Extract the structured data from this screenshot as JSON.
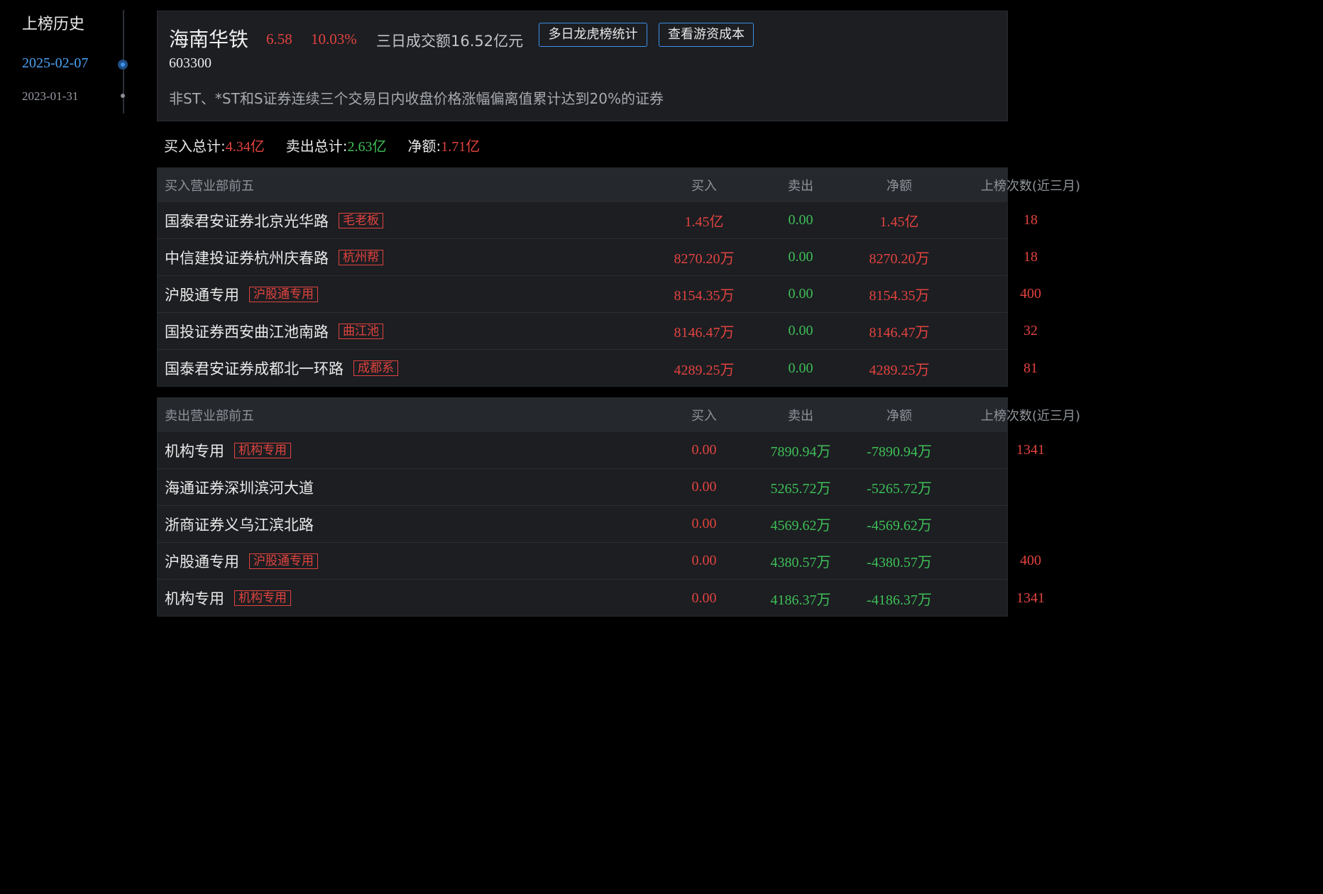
{
  "history": {
    "title": "上榜历史",
    "dates": [
      {
        "label": "2025-02-07",
        "active": true
      },
      {
        "label": "2023-01-31",
        "active": false
      }
    ]
  },
  "stock": {
    "name": "海南华铁",
    "price": "6.58",
    "change_pct": "10.03%",
    "turnover": "三日成交额16.52亿元",
    "code": "603300",
    "reason": "非ST、*ST和S证券连续三个交易日内收盘价格涨幅偏离值累计达到20%的证券",
    "buttons": {
      "multi_day": "多日龙虎榜统计",
      "cost": "查看游资成本"
    }
  },
  "totals": {
    "buy_label": "买入总计:",
    "buy_value": "4.34亿",
    "sell_label": "卖出总计:",
    "sell_value": "2.63亿",
    "net_label": "净额:",
    "net_value": "1.71亿"
  },
  "buy_table": {
    "headers": {
      "name": "买入营业部前五",
      "buy": "买入",
      "sell": "卖出",
      "net": "净额",
      "count": "上榜次数(近三月)"
    },
    "rows": [
      {
        "name": "国泰君安证券北京光华路",
        "tag": "毛老板",
        "buy": "1.45亿",
        "sell": "0.00",
        "net": "1.45亿",
        "count": "18"
      },
      {
        "name": "中信建投证券杭州庆春路",
        "tag": "杭州帮",
        "buy": "8270.20万",
        "sell": "0.00",
        "net": "8270.20万",
        "count": "18"
      },
      {
        "name": "沪股通专用",
        "tag": "沪股通专用",
        "buy": "8154.35万",
        "sell": "0.00",
        "net": "8154.35万",
        "count": "400"
      },
      {
        "name": "国投证券西安曲江池南路",
        "tag": "曲江池",
        "buy": "8146.47万",
        "sell": "0.00",
        "net": "8146.47万",
        "count": "32"
      },
      {
        "name": "国泰君安证券成都北一环路",
        "tag": "成都系",
        "buy": "4289.25万",
        "sell": "0.00",
        "net": "4289.25万",
        "count": "81"
      }
    ]
  },
  "sell_table": {
    "headers": {
      "name": "卖出营业部前五",
      "buy": "买入",
      "sell": "卖出",
      "net": "净额",
      "count": "上榜次数(近三月)"
    },
    "rows": [
      {
        "name": "机构专用",
        "tag": "机构专用",
        "buy": "0.00",
        "sell": "7890.94万",
        "net": "-7890.94万",
        "count": "1341"
      },
      {
        "name": "海通证券深圳滨河大道",
        "tag": "",
        "buy": "0.00",
        "sell": "5265.72万",
        "net": "-5265.72万",
        "count": ""
      },
      {
        "name": "浙商证券义乌江滨北路",
        "tag": "",
        "buy": "0.00",
        "sell": "4569.62万",
        "net": "-4569.62万",
        "count": ""
      },
      {
        "name": "沪股通专用",
        "tag": "沪股通专用",
        "buy": "0.00",
        "sell": "4380.57万",
        "net": "-4380.57万",
        "count": "400"
      },
      {
        "name": "机构专用",
        "tag": "机构专用",
        "buy": "0.00",
        "sell": "4186.37万",
        "net": "-4186.37万",
        "count": "1341"
      }
    ]
  },
  "colors": {
    "up": "#e2433f",
    "down": "#3fbf57",
    "accent": "#4aa3f5"
  }
}
